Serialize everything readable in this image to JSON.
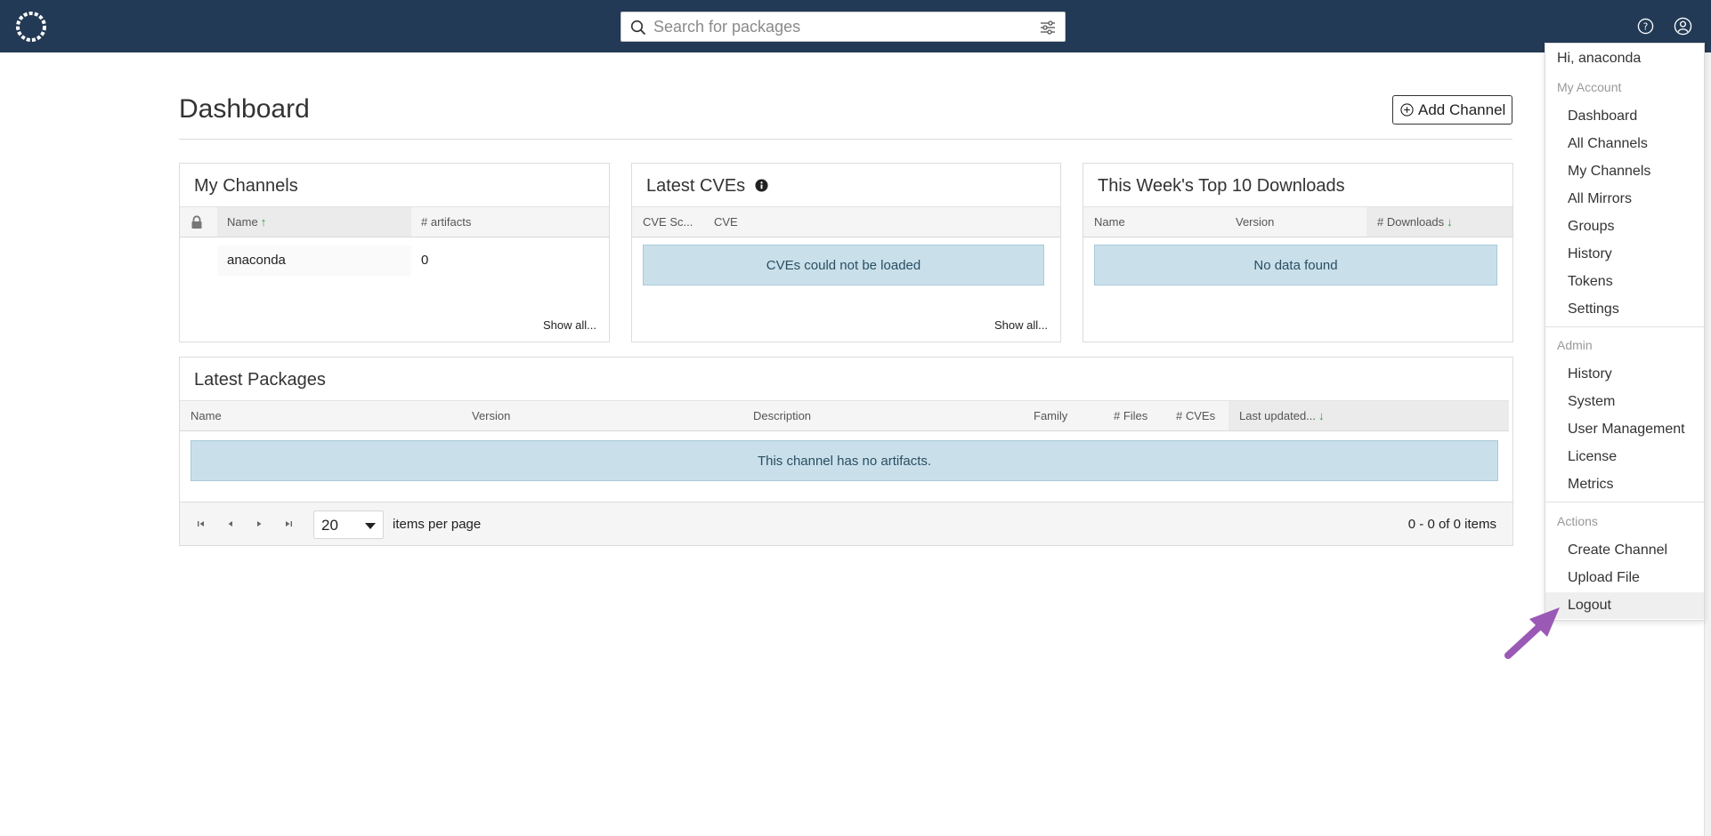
{
  "search": {
    "placeholder": "Search for packages"
  },
  "page": {
    "title": "Dashboard",
    "add_channel_label": "Add Channel"
  },
  "my_channels": {
    "title": "My Channels",
    "columns": [
      "Name",
      "# artifacts"
    ],
    "rows": [
      {
        "name": "anaconda",
        "artifacts": "0"
      }
    ],
    "show_all": "Show all..."
  },
  "latest_cves": {
    "title": "Latest CVEs",
    "columns": [
      "CVE Sc...",
      "CVE"
    ],
    "notice": "CVEs could not be loaded",
    "show_all": "Show all..."
  },
  "top_downloads": {
    "title": "This Week's Top 10 Downloads",
    "columns": [
      "Name",
      "Version",
      "# Downloads"
    ],
    "notice": "No data found"
  },
  "latest_packages": {
    "title": "Latest Packages",
    "columns": [
      "Name",
      "Version",
      "Description",
      "Family",
      "# Files",
      "# CVEs",
      "Last updated..."
    ],
    "notice": "This channel has no artifacts.",
    "per_page_value": "20",
    "per_page_label": "items per page",
    "range": "0 - 0 of 0 items"
  },
  "menu": {
    "greeting": "Hi, anaconda",
    "sections": [
      {
        "label": "My Account",
        "items": [
          "Dashboard",
          "All Channels",
          "My Channels",
          "All Mirrors",
          "Groups",
          "History",
          "Tokens",
          "Settings"
        ]
      },
      {
        "label": "Admin",
        "items": [
          "History",
          "System",
          "User Management",
          "License",
          "Metrics"
        ]
      },
      {
        "label": "Actions",
        "items": [
          "Create Channel",
          "Upload File",
          "Logout"
        ]
      }
    ],
    "hovered_item": "Logout"
  },
  "colors": {
    "topbar": "#223a55",
    "sort_arrow": "#2a9d3b",
    "notice_bg": "#c9e0ea",
    "pointer_arrow": "#9b59b6"
  },
  "icons": [
    "anaconda-logo-icon",
    "search-icon",
    "filter-icon",
    "help-icon",
    "user-icon",
    "plus-circle-icon",
    "lock-icon",
    "info-icon",
    "first-page-icon",
    "prev-page-icon",
    "next-page-icon",
    "last-page-icon",
    "annotation-arrow-icon"
  ]
}
